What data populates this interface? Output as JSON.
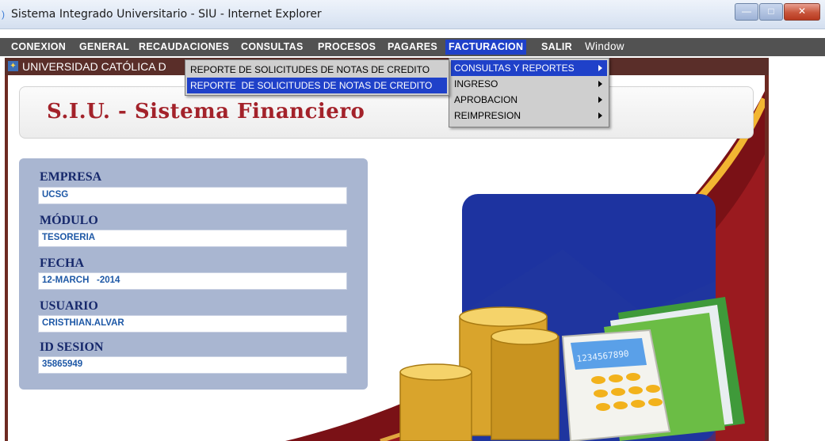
{
  "window": {
    "title": "Sistema Integrado Universitario - SIU - Internet Explorer",
    "minimize_glyph": "—",
    "maximize_glyph": "□",
    "close_glyph": "✕"
  },
  "menubar": {
    "items": [
      {
        "label": "CONEXION"
      },
      {
        "label": "GENERAL"
      },
      {
        "label": "RECAUDACIONES"
      },
      {
        "label": "CONSULTAS"
      },
      {
        "label": "PROCESOS"
      },
      {
        "label": "PAGARES"
      },
      {
        "label": "FACTURACION"
      },
      {
        "label": "SALIR"
      },
      {
        "label": "Window"
      }
    ]
  },
  "frame": {
    "title": "UNIVERSIDAD CATÓLICA D"
  },
  "banner": {
    "title": "S.I.U. - Sistema Financiero"
  },
  "info": {
    "empresa_label": "EMPRESA",
    "empresa_value": "UCSG",
    "modulo_label": "MÓDULO",
    "modulo_value": "TESORERIA",
    "fecha_label": "FECHA",
    "fecha_value": "12-MARCH   -2014",
    "usuario_label": "USUARIO",
    "usuario_value": "CRISTHIAN.ALVAR",
    "sesion_label": "ID SESION",
    "sesion_value": "35865949"
  },
  "facturacion_menu": {
    "items": [
      {
        "label": "CONSULTAS Y REPORTES",
        "submenu": true
      },
      {
        "label": "INGRESO",
        "submenu": true
      },
      {
        "label": "APROBACION",
        "submenu": true
      },
      {
        "label": "REIMPRESION",
        "submenu": true
      }
    ]
  },
  "reportes_menu": {
    "items": [
      {
        "label": "REPORTE DE SOLICITUDES DE NOTAS DE CREDITO"
      },
      {
        "label": "REPORTE  DE SOLICITUDES DE NOTAS DE CREDITO"
      }
    ]
  },
  "art": {
    "calculator_display": "1234567890"
  },
  "colors": {
    "menubar": "#525252",
    "highlight": "#1f41c9",
    "frame": "#6e2a22",
    "banner_title": "#a3222a",
    "panel": "#a9b6d1"
  }
}
